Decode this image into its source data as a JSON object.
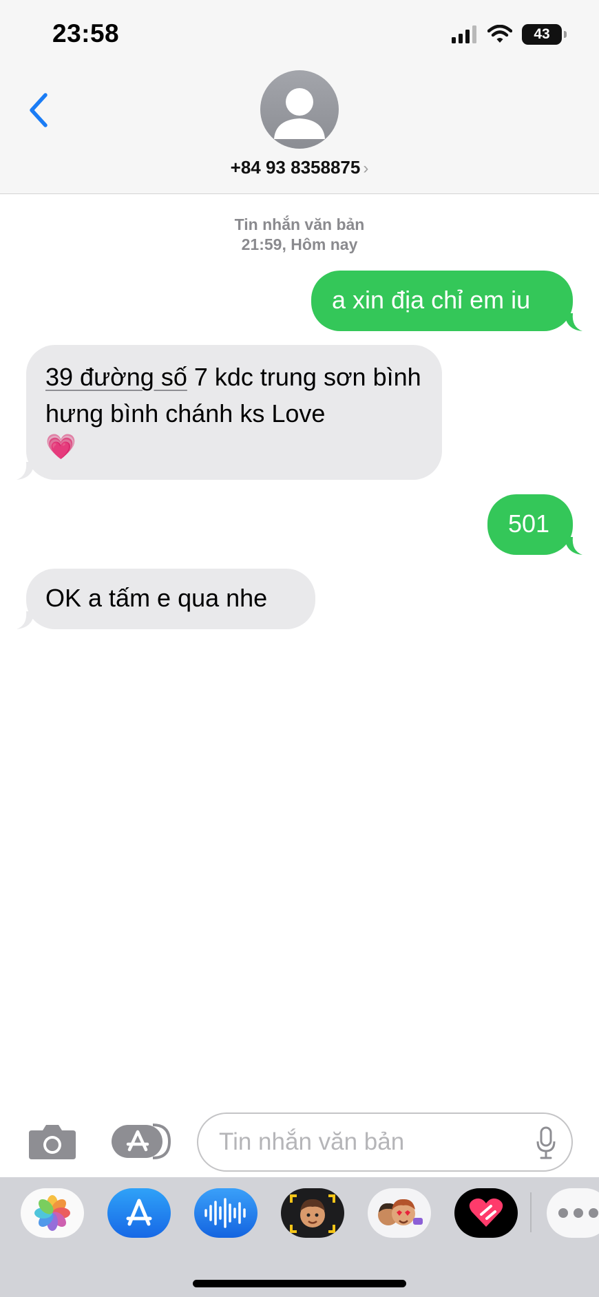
{
  "status_bar": {
    "time": "23:58",
    "battery_level": "43",
    "icons": [
      "signal-icon",
      "wifi-icon",
      "battery-icon"
    ]
  },
  "header": {
    "back_icon": "chevron-left-icon",
    "avatar_icon": "person-icon",
    "contact_number": "+84 93 8358875",
    "contact_chevron": "›"
  },
  "conversation": {
    "meta_label": "Tin nhắn văn bản",
    "meta_time": "21:59, Hôm nay",
    "messages": [
      {
        "direction": "outgoing",
        "text": "a xin địa chỉ em iu"
      },
      {
        "direction": "incoming",
        "address_text": "39 đường số",
        "text": " 7 kdc trung sơn bình hưng bình chánh ks Love",
        "emoji": "💗"
      },
      {
        "direction": "outgoing",
        "text": "501"
      },
      {
        "direction": "incoming",
        "text": "OK a tấm e qua nhe"
      }
    ]
  },
  "composer": {
    "camera_icon": "camera-icon",
    "apps_icon": "app-store-icon",
    "placeholder": "Tin nhắn văn bản",
    "value": "",
    "mic_icon": "microphone-icon"
  },
  "app_drawer": {
    "apps": [
      "photos-icon",
      "app-store-icon",
      "audio-message-icon",
      "memoji-icon",
      "memoji-stickers-icon",
      "digital-touch-icon",
      "more-icon"
    ]
  },
  "colors": {
    "outgoing_bubble": "#34c759",
    "incoming_bubble": "#e9e9eb",
    "accent": "#1a7cf5",
    "meta_text": "#8a8a8e"
  }
}
